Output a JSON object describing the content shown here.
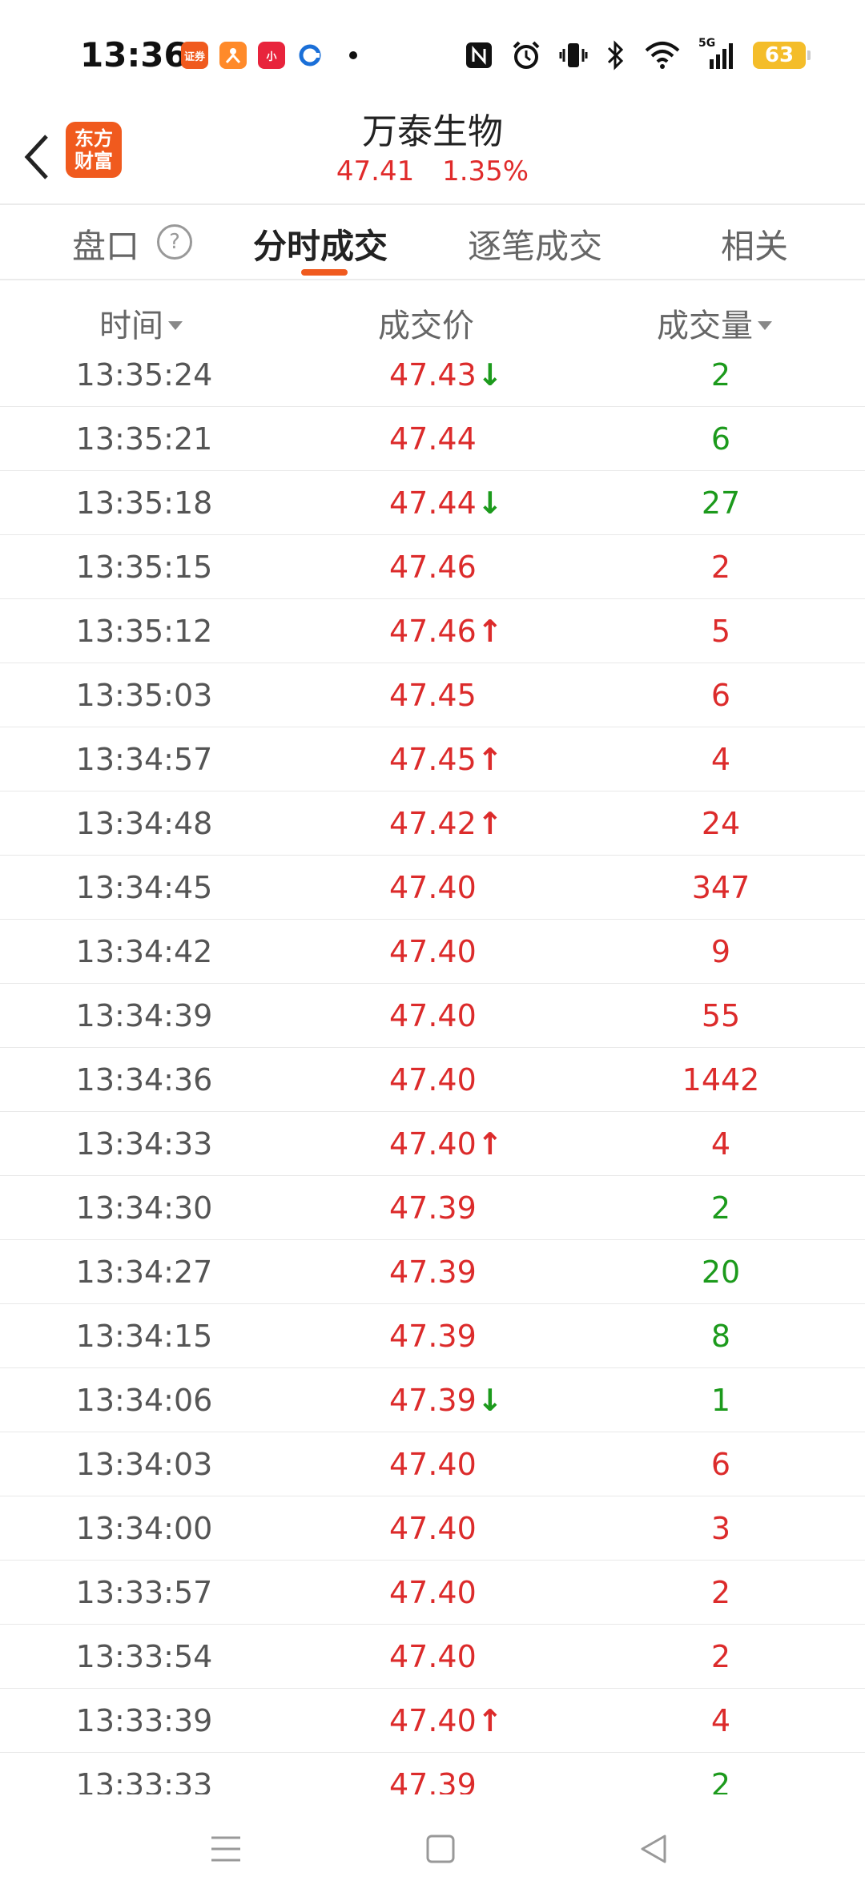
{
  "status": {
    "time": "13:36",
    "notif_apps": [
      {
        "name": "securities-app-icon",
        "color": "#f05a1e",
        "text": "证券"
      },
      {
        "name": "xiaohongshu-like-icon",
        "color": "#ff7a1a",
        "text": ""
      },
      {
        "name": "red-app-icon",
        "color": "#e8243c",
        "text": "小"
      },
      {
        "name": "blue-app-icon",
        "color": "#1a7de0",
        "text": ""
      }
    ],
    "network": "5G",
    "battery": "63"
  },
  "header": {
    "logo_text": "东方财富",
    "stock_name": "万泰生物",
    "price": "47.41",
    "change_pct": "1.35%"
  },
  "tabs": [
    {
      "label": "盘口",
      "active": false
    },
    {
      "label": "分时成交",
      "active": true
    },
    {
      "label": "逐笔成交",
      "active": false
    },
    {
      "label": "相关",
      "active": false
    }
  ],
  "table": {
    "headers": {
      "time": "时间",
      "price": "成交价",
      "volume": "成交量"
    },
    "colors": {
      "up": "#dc2b2b",
      "down": "#1c9a1c"
    },
    "rows": [
      {
        "time": "13:35:24",
        "price": "47.43",
        "arrow": "down",
        "volume": "2",
        "vol_dir": "down"
      },
      {
        "time": "13:35:21",
        "price": "47.44",
        "arrow": "",
        "volume": "6",
        "vol_dir": "down"
      },
      {
        "time": "13:35:18",
        "price": "47.44",
        "arrow": "down",
        "volume": "27",
        "vol_dir": "down"
      },
      {
        "time": "13:35:15",
        "price": "47.46",
        "arrow": "",
        "volume": "2",
        "vol_dir": "up"
      },
      {
        "time": "13:35:12",
        "price": "47.46",
        "arrow": "up",
        "volume": "5",
        "vol_dir": "up"
      },
      {
        "time": "13:35:03",
        "price": "47.45",
        "arrow": "",
        "volume": "6",
        "vol_dir": "up"
      },
      {
        "time": "13:34:57",
        "price": "47.45",
        "arrow": "up",
        "volume": "4",
        "vol_dir": "up"
      },
      {
        "time": "13:34:48",
        "price": "47.42",
        "arrow": "up",
        "volume": "24",
        "vol_dir": "up"
      },
      {
        "time": "13:34:45",
        "price": "47.40",
        "arrow": "",
        "volume": "347",
        "vol_dir": "up"
      },
      {
        "time": "13:34:42",
        "price": "47.40",
        "arrow": "",
        "volume": "9",
        "vol_dir": "up"
      },
      {
        "time": "13:34:39",
        "price": "47.40",
        "arrow": "",
        "volume": "55",
        "vol_dir": "up"
      },
      {
        "time": "13:34:36",
        "price": "47.40",
        "arrow": "",
        "volume": "1442",
        "vol_dir": "up"
      },
      {
        "time": "13:34:33",
        "price": "47.40",
        "arrow": "up",
        "volume": "4",
        "vol_dir": "up"
      },
      {
        "time": "13:34:30",
        "price": "47.39",
        "arrow": "",
        "volume": "2",
        "vol_dir": "down"
      },
      {
        "time": "13:34:27",
        "price": "47.39",
        "arrow": "",
        "volume": "20",
        "vol_dir": "down"
      },
      {
        "time": "13:34:15",
        "price": "47.39",
        "arrow": "",
        "volume": "8",
        "vol_dir": "down"
      },
      {
        "time": "13:34:06",
        "price": "47.39",
        "arrow": "down",
        "volume": "1",
        "vol_dir": "down"
      },
      {
        "time": "13:34:03",
        "price": "47.40",
        "arrow": "",
        "volume": "6",
        "vol_dir": "up"
      },
      {
        "time": "13:34:00",
        "price": "47.40",
        "arrow": "",
        "volume": "3",
        "vol_dir": "up"
      },
      {
        "time": "13:33:57",
        "price": "47.40",
        "arrow": "",
        "volume": "2",
        "vol_dir": "up"
      },
      {
        "time": "13:33:54",
        "price": "47.40",
        "arrow": "",
        "volume": "2",
        "vol_dir": "up"
      },
      {
        "time": "13:33:39",
        "price": "47.40",
        "arrow": "up",
        "volume": "4",
        "vol_dir": "up"
      },
      {
        "time": "13:33:33",
        "price": "47.39",
        "arrow": "",
        "volume": "2",
        "vol_dir": "down"
      }
    ]
  },
  "nav": [
    {
      "name": "menu-icon"
    },
    {
      "name": "home-square-icon"
    },
    {
      "name": "back-triangle-icon"
    }
  ]
}
